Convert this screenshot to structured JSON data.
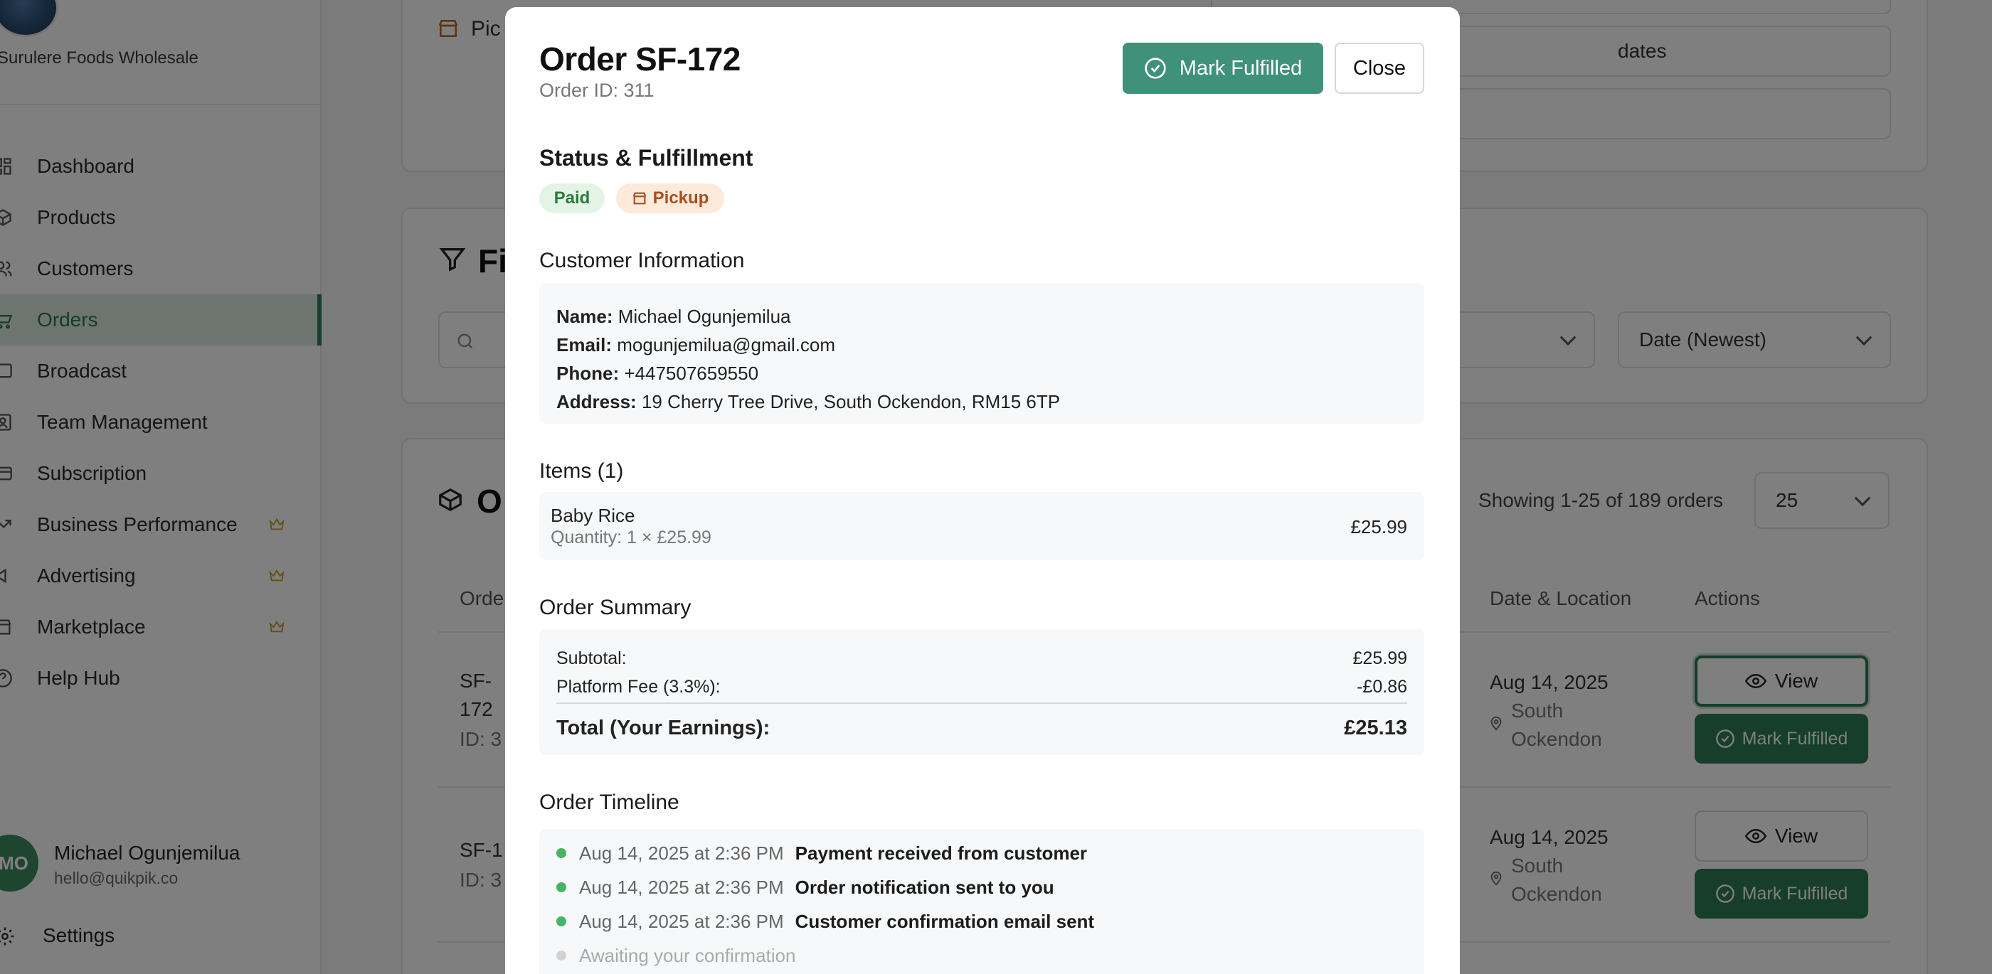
{
  "sidebar": {
    "company": "Surulere Foods Wholesale",
    "items": [
      {
        "label": "Dashboard",
        "icon": "grid-icon",
        "active": false,
        "premium": false
      },
      {
        "label": "Products",
        "icon": "box-icon",
        "active": false,
        "premium": false
      },
      {
        "label": "Customers",
        "icon": "users-icon",
        "active": false,
        "premium": false
      },
      {
        "label": "Orders",
        "icon": "cart-icon",
        "active": true,
        "premium": false
      },
      {
        "label": "Broadcast",
        "icon": "broadcast-icon",
        "active": false,
        "premium": false
      },
      {
        "label": "Team Management",
        "icon": "team-icon",
        "active": false,
        "premium": false
      },
      {
        "label": "Subscription",
        "icon": "card-icon",
        "active": false,
        "premium": false
      },
      {
        "label": "Business Performance",
        "icon": "trend-icon",
        "active": false,
        "premium": true
      },
      {
        "label": "Advertising",
        "icon": "megaphone-icon",
        "active": false,
        "premium": true
      },
      {
        "label": "Marketplace",
        "icon": "store-icon",
        "active": false,
        "premium": true
      },
      {
        "label": "Help Hub",
        "icon": "help-icon",
        "active": false,
        "premium": false
      }
    ],
    "user": {
      "initials": "MO",
      "name": "Michael Ogunjemilua",
      "email": "hello@quikpik.co"
    },
    "settings_label": "Settings"
  },
  "background": {
    "pickup_fragment": "Pic",
    "updates_fragment": "dates",
    "filters_fragment": "Fi",
    "search_fragment": "S",
    "sort_value": "Date (Newest)",
    "orders_fragment": "O",
    "showing_text": "Showing 1-25 of 189 orders",
    "page_size": "25",
    "headers": {
      "order": "Orde",
      "date_location": "Date & Location",
      "actions": "Actions"
    },
    "rows": [
      {
        "order_lines": [
          "SF-",
          "172"
        ],
        "id_fragment": "ID: 3",
        "date": "Aug 14, 2025",
        "location": [
          "South",
          "Ockendon"
        ]
      },
      {
        "order_lines": [
          "SF-1"
        ],
        "id_fragment": "ID: 3",
        "date": "Aug 14, 2025",
        "location": [
          "South",
          "Ockendon"
        ]
      }
    ],
    "view_label": "View",
    "mark_fulfilled_label": "Mark Fulfilled"
  },
  "modal": {
    "title": "Order SF-172",
    "order_id": "Order ID: 311",
    "mark_fulfilled_label": "Mark Fulfilled",
    "close_label": "Close",
    "status_title": "Status & Fulfillment",
    "badges": {
      "payment": "Paid",
      "fulfillment": "Pickup"
    },
    "customer_title": "Customer Information",
    "customer": {
      "name_label": "Name:",
      "name": "Michael Ogunjemilua",
      "email_label": "Email:",
      "email": "mogunjemilua@gmail.com",
      "phone_label": "Phone:",
      "phone": "+447507659550",
      "address_label": "Address:",
      "address": "19 Cherry Tree Drive, South Ockendon, RM15 6TP"
    },
    "items_title": "Items (1)",
    "items": [
      {
        "name": "Baby Rice",
        "quantity": "Quantity: 1 × £25.99",
        "price": "£25.99"
      }
    ],
    "summary_title": "Order Summary",
    "summary": {
      "subtotal_label": "Subtotal:",
      "subtotal": "£25.99",
      "fee_label": "Platform Fee (3.3%):",
      "fee": "-£0.86",
      "total_label": "Total (Your Earnings):",
      "total": "£25.13"
    },
    "timeline_title": "Order Timeline",
    "timeline": [
      {
        "date": "Aug 14, 2025 at 2:36 PM",
        "text": "Payment received from customer",
        "done": true
      },
      {
        "date": "Aug 14, 2025 at 2:36 PM",
        "text": "Order notification sent to you",
        "done": true
      },
      {
        "date": "Aug 14, 2025 at 2:36 PM",
        "text": "Customer confirmation email sent",
        "done": true
      },
      {
        "date": "Awaiting your confirmation",
        "text": "",
        "done": false
      }
    ]
  },
  "colors": {
    "brand": "#2e7d57",
    "modal_button": "#3f9179",
    "paid_bg": "#e3f4e6",
    "pickup_bg": "#fdeadb",
    "dot_done": "#46b563",
    "dot_pending": "#d2d2d2"
  }
}
